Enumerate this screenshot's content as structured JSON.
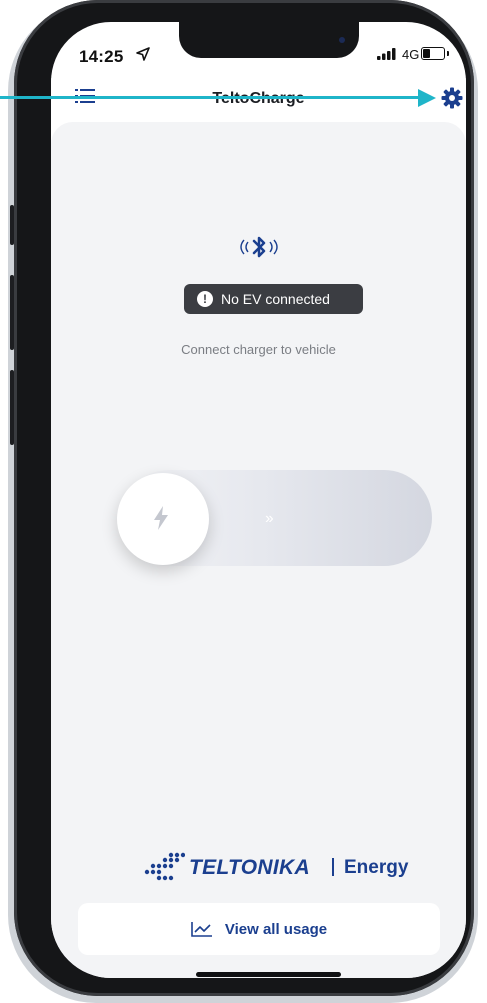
{
  "status_bar": {
    "time": "14:25",
    "network": "4G",
    "icons": [
      "location-arrow-icon",
      "signal-bars-icon",
      "battery-icon"
    ]
  },
  "header": {
    "title": "TeltoCharge",
    "menu_icon": "list-menu-icon",
    "settings_icon": "gear-icon"
  },
  "main": {
    "bluetooth_icon": "bluetooth-signal-icon",
    "ev_status": "No EV connected",
    "hint": "Connect charger to vehicle",
    "slider": {
      "icon": "lightning-bolt-icon",
      "chevrons": "››"
    }
  },
  "brand": {
    "name": "TELTONIKA",
    "separator": "|",
    "product": "Energy"
  },
  "footer": {
    "usage_button": "View all usage",
    "usage_icon": "line-chart-icon"
  },
  "colors": {
    "brand_blue": "#1b3f8f",
    "annotation": "#1fb5c9",
    "badge_bg": "#3b3d42",
    "content_bg": "#f3f4f6"
  }
}
